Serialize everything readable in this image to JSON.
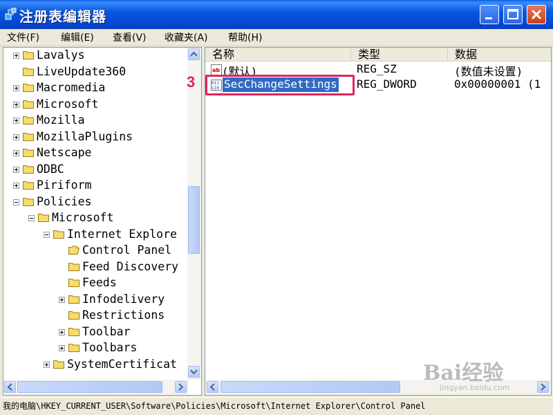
{
  "window": {
    "title": "注册表编辑器"
  },
  "menu": [
    {
      "label": "文件(F)"
    },
    {
      "label": "编辑(E)"
    },
    {
      "label": "查看(V)"
    },
    {
      "label": "收藏夹(A)"
    },
    {
      "label": "帮助(H)"
    }
  ],
  "tree": {
    "items": [
      {
        "label": "Lavalys",
        "expander": "plus"
      },
      {
        "label": "LiveUpdate360",
        "expander": "none"
      },
      {
        "label": "Macromedia",
        "expander": "plus"
      },
      {
        "label": "Microsoft",
        "expander": "plus"
      },
      {
        "label": "Mozilla",
        "expander": "plus"
      },
      {
        "label": "MozillaPlugins",
        "expander": "plus"
      },
      {
        "label": "Netscape",
        "expander": "plus"
      },
      {
        "label": "ODBC",
        "expander": "plus"
      },
      {
        "label": "Piriform",
        "expander": "plus"
      },
      {
        "label": "Policies",
        "expander": "minus"
      },
      {
        "label": "Microsoft",
        "expander": "minus"
      },
      {
        "label": "Internet Explore",
        "expander": "minus"
      },
      {
        "label": "Control Panel",
        "expander": "none",
        "selected": true
      },
      {
        "label": "Feed Discovery",
        "expander": "none"
      },
      {
        "label": "Feeds",
        "expander": "none"
      },
      {
        "label": "Infodelivery",
        "expander": "plus"
      },
      {
        "label": "Restrictions",
        "expander": "none"
      },
      {
        "label": "Toolbar",
        "expander": "plus"
      },
      {
        "label": "Toolbars",
        "expander": "plus"
      },
      {
        "label": "SystemCertificat",
        "expander": "plus"
      }
    ]
  },
  "list": {
    "columns": [
      {
        "label": "名称"
      },
      {
        "label": "类型"
      },
      {
        "label": "数据"
      }
    ],
    "rows": [
      {
        "name": "(默认)",
        "type": "REG_SZ",
        "data": "(数值未设置)",
        "icon": "string-value-icon"
      },
      {
        "name": "SecChangeSettings",
        "type": "REG_DWORD",
        "data": "0x00000001 (1",
        "icon": "dword-value-icon",
        "selected": true
      }
    ]
  },
  "annotation": {
    "step": "3",
    "color": "#e0245e"
  },
  "statusbar": {
    "path": "我的电脑\\HKEY_CURRENT_USER\\Software\\Policies\\Microsoft\\Internet Explorer\\Control Panel"
  },
  "watermark": {
    "text": "Bai经验",
    "sub": "jingyan.baidu.com"
  },
  "colors": {
    "titlebar": "#0a5ee8",
    "selection": "#316ac5",
    "annotation": "#e0245e"
  }
}
